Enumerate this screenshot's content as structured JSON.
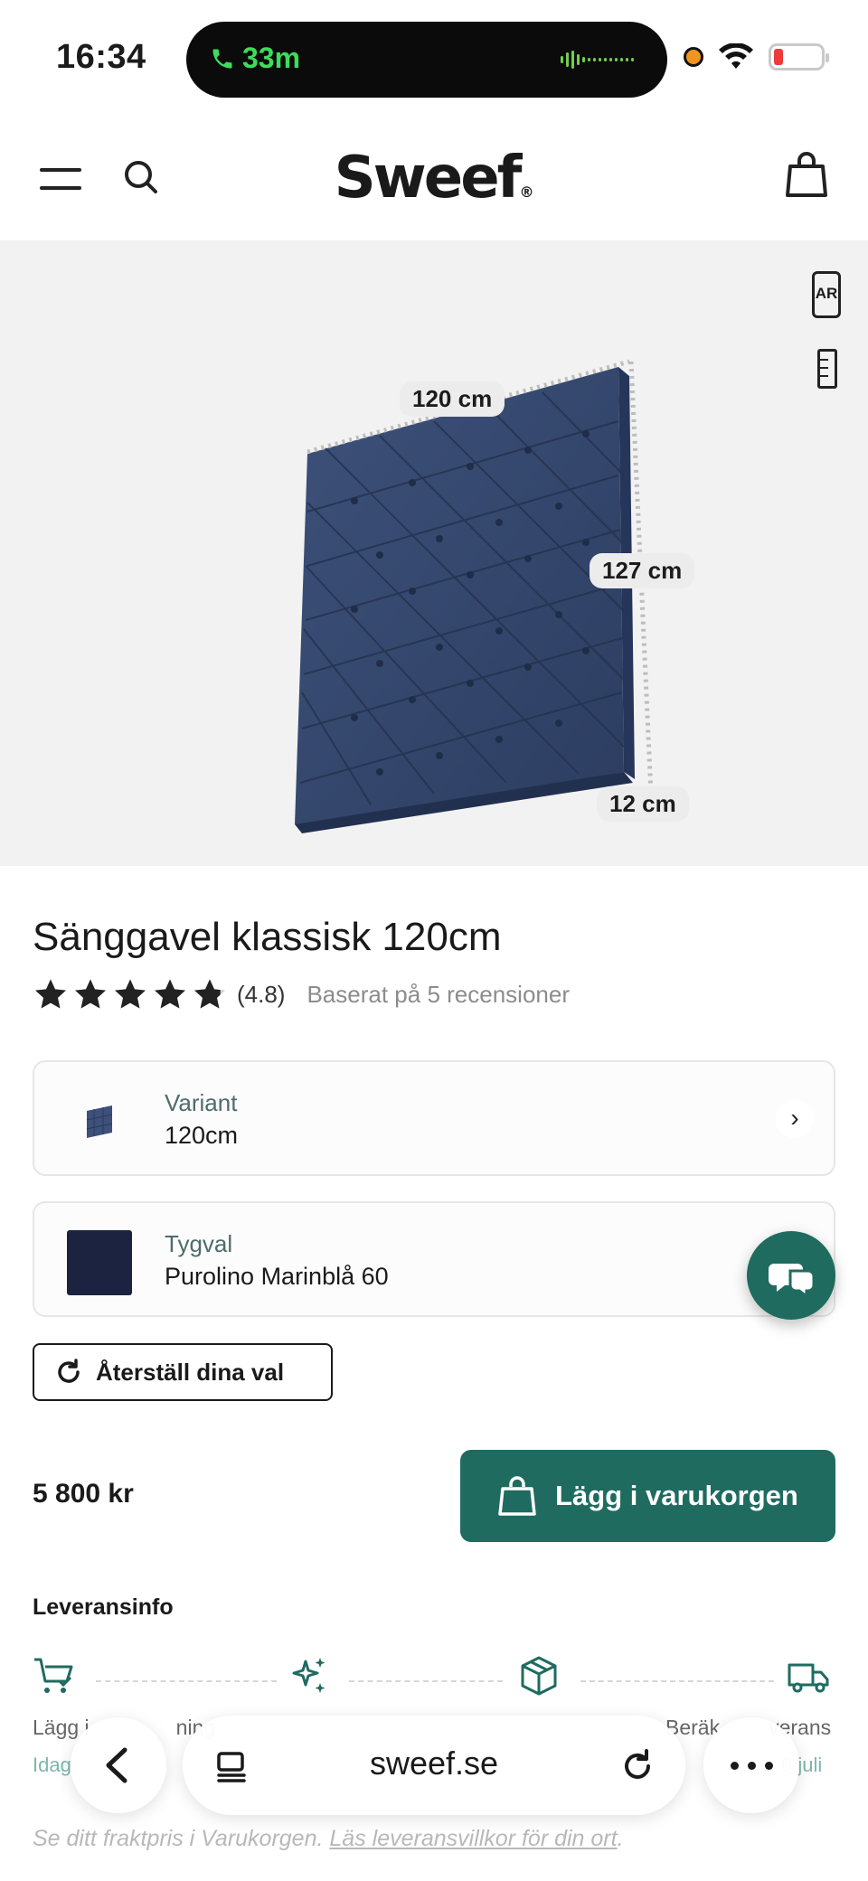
{
  "status_bar": {
    "time": "16:34",
    "call_duration": "33m"
  },
  "header": {
    "logo": "Sweef",
    "logo_mark": "®"
  },
  "gallery": {
    "ar_label": "AR",
    "dimensions": {
      "width": "120 cm",
      "height": "127 cm",
      "depth": "12 cm"
    }
  },
  "product": {
    "title": "Sänggavel klassisk 120cm",
    "rating_value": "(4.8)",
    "rating_stars": 4.8,
    "reviews_text": "Baserat på 5 recensioner",
    "options": [
      {
        "label": "Variant",
        "value": "120cm"
      },
      {
        "label": "Tygval",
        "value": "Purolino Marinblå 60"
      }
    ],
    "reset_label": "Återställ dina val",
    "price": "5 800 kr",
    "add_to_cart_label": "Lägg i varukorgen"
  },
  "delivery": {
    "title": "Leveransinfo",
    "steps": [
      {
        "text": "Lägg i",
        "text_end": "ning",
        "sub": "Idag"
      },
      {
        "text": "Beräk",
        "text_end": "verans",
        "sub": "0 juli"
      }
    ],
    "fine_print_prefix": "Se ditt fraktpris i Varukorgen.",
    "fine_print_link": "Läs leveransvillkor för din ort",
    "fine_print_suffix": "."
  },
  "browser": {
    "url": "sweef.se"
  },
  "colors": {
    "brand_green": "#1f6b60",
    "fabric_blue": "#34476e"
  }
}
